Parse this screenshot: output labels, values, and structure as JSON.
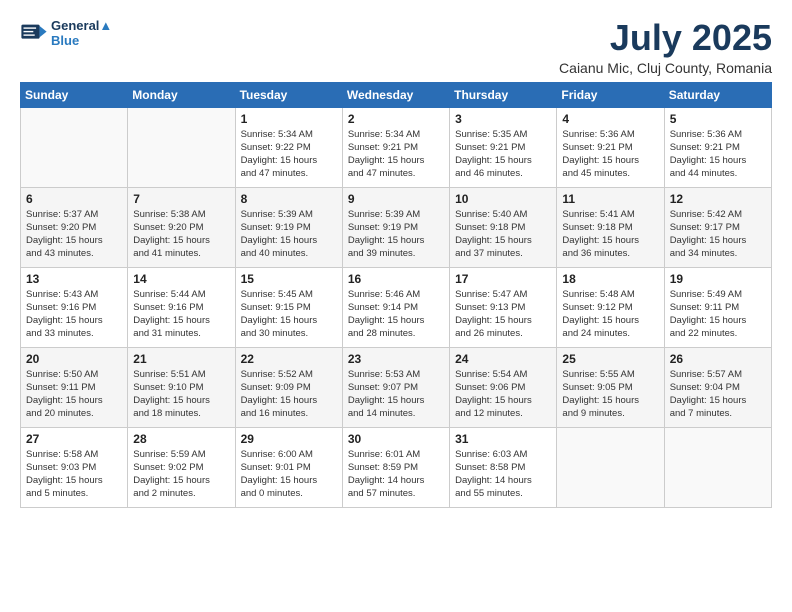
{
  "logo": {
    "line1": "General",
    "line2": "Blue"
  },
  "title": "July 2025",
  "subtitle": "Caianu Mic, Cluj County, Romania",
  "weekdays": [
    "Sunday",
    "Monday",
    "Tuesday",
    "Wednesday",
    "Thursday",
    "Friday",
    "Saturday"
  ],
  "rows": [
    [
      {
        "day": "",
        "info": ""
      },
      {
        "day": "",
        "info": ""
      },
      {
        "day": "1",
        "info": "Sunrise: 5:34 AM\nSunset: 9:22 PM\nDaylight: 15 hours\nand 47 minutes."
      },
      {
        "day": "2",
        "info": "Sunrise: 5:34 AM\nSunset: 9:21 PM\nDaylight: 15 hours\nand 47 minutes."
      },
      {
        "day": "3",
        "info": "Sunrise: 5:35 AM\nSunset: 9:21 PM\nDaylight: 15 hours\nand 46 minutes."
      },
      {
        "day": "4",
        "info": "Sunrise: 5:36 AM\nSunset: 9:21 PM\nDaylight: 15 hours\nand 45 minutes."
      },
      {
        "day": "5",
        "info": "Sunrise: 5:36 AM\nSunset: 9:21 PM\nDaylight: 15 hours\nand 44 minutes."
      }
    ],
    [
      {
        "day": "6",
        "info": "Sunrise: 5:37 AM\nSunset: 9:20 PM\nDaylight: 15 hours\nand 43 minutes."
      },
      {
        "day": "7",
        "info": "Sunrise: 5:38 AM\nSunset: 9:20 PM\nDaylight: 15 hours\nand 41 minutes."
      },
      {
        "day": "8",
        "info": "Sunrise: 5:39 AM\nSunset: 9:19 PM\nDaylight: 15 hours\nand 40 minutes."
      },
      {
        "day": "9",
        "info": "Sunrise: 5:39 AM\nSunset: 9:19 PM\nDaylight: 15 hours\nand 39 minutes."
      },
      {
        "day": "10",
        "info": "Sunrise: 5:40 AM\nSunset: 9:18 PM\nDaylight: 15 hours\nand 37 minutes."
      },
      {
        "day": "11",
        "info": "Sunrise: 5:41 AM\nSunset: 9:18 PM\nDaylight: 15 hours\nand 36 minutes."
      },
      {
        "day": "12",
        "info": "Sunrise: 5:42 AM\nSunset: 9:17 PM\nDaylight: 15 hours\nand 34 minutes."
      }
    ],
    [
      {
        "day": "13",
        "info": "Sunrise: 5:43 AM\nSunset: 9:16 PM\nDaylight: 15 hours\nand 33 minutes."
      },
      {
        "day": "14",
        "info": "Sunrise: 5:44 AM\nSunset: 9:16 PM\nDaylight: 15 hours\nand 31 minutes."
      },
      {
        "day": "15",
        "info": "Sunrise: 5:45 AM\nSunset: 9:15 PM\nDaylight: 15 hours\nand 30 minutes."
      },
      {
        "day": "16",
        "info": "Sunrise: 5:46 AM\nSunset: 9:14 PM\nDaylight: 15 hours\nand 28 minutes."
      },
      {
        "day": "17",
        "info": "Sunrise: 5:47 AM\nSunset: 9:13 PM\nDaylight: 15 hours\nand 26 minutes."
      },
      {
        "day": "18",
        "info": "Sunrise: 5:48 AM\nSunset: 9:12 PM\nDaylight: 15 hours\nand 24 minutes."
      },
      {
        "day": "19",
        "info": "Sunrise: 5:49 AM\nSunset: 9:11 PM\nDaylight: 15 hours\nand 22 minutes."
      }
    ],
    [
      {
        "day": "20",
        "info": "Sunrise: 5:50 AM\nSunset: 9:11 PM\nDaylight: 15 hours\nand 20 minutes."
      },
      {
        "day": "21",
        "info": "Sunrise: 5:51 AM\nSunset: 9:10 PM\nDaylight: 15 hours\nand 18 minutes."
      },
      {
        "day": "22",
        "info": "Sunrise: 5:52 AM\nSunset: 9:09 PM\nDaylight: 15 hours\nand 16 minutes."
      },
      {
        "day": "23",
        "info": "Sunrise: 5:53 AM\nSunset: 9:07 PM\nDaylight: 15 hours\nand 14 minutes."
      },
      {
        "day": "24",
        "info": "Sunrise: 5:54 AM\nSunset: 9:06 PM\nDaylight: 15 hours\nand 12 minutes."
      },
      {
        "day": "25",
        "info": "Sunrise: 5:55 AM\nSunset: 9:05 PM\nDaylight: 15 hours\nand 9 minutes."
      },
      {
        "day": "26",
        "info": "Sunrise: 5:57 AM\nSunset: 9:04 PM\nDaylight: 15 hours\nand 7 minutes."
      }
    ],
    [
      {
        "day": "27",
        "info": "Sunrise: 5:58 AM\nSunset: 9:03 PM\nDaylight: 15 hours\nand 5 minutes."
      },
      {
        "day": "28",
        "info": "Sunrise: 5:59 AM\nSunset: 9:02 PM\nDaylight: 15 hours\nand 2 minutes."
      },
      {
        "day": "29",
        "info": "Sunrise: 6:00 AM\nSunset: 9:01 PM\nDaylight: 15 hours\nand 0 minutes."
      },
      {
        "day": "30",
        "info": "Sunrise: 6:01 AM\nSunset: 8:59 PM\nDaylight: 14 hours\nand 57 minutes."
      },
      {
        "day": "31",
        "info": "Sunrise: 6:03 AM\nSunset: 8:58 PM\nDaylight: 14 hours\nand 55 minutes."
      },
      {
        "day": "",
        "info": ""
      },
      {
        "day": "",
        "info": ""
      }
    ]
  ]
}
